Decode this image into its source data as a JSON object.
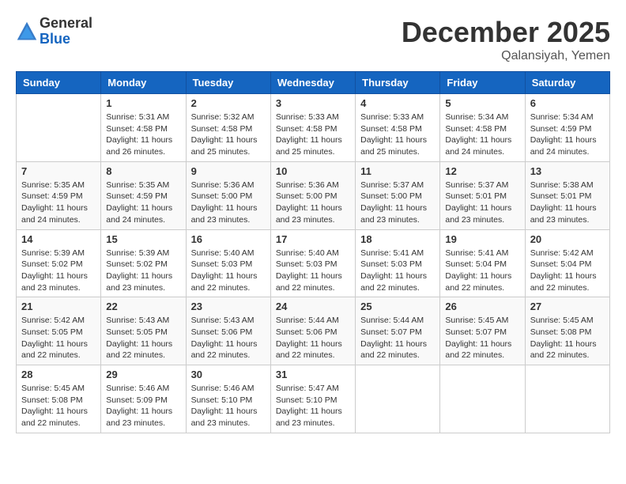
{
  "header": {
    "logo_general": "General",
    "logo_blue": "Blue",
    "month_title": "December 2025",
    "location": "Qalansiyah, Yemen"
  },
  "calendar": {
    "days_of_week": [
      "Sunday",
      "Monday",
      "Tuesday",
      "Wednesday",
      "Thursday",
      "Friday",
      "Saturday"
    ],
    "weeks": [
      [
        {
          "day": "",
          "info": ""
        },
        {
          "day": "1",
          "info": "Sunrise: 5:31 AM\nSunset: 4:58 PM\nDaylight: 11 hours\nand 26 minutes."
        },
        {
          "day": "2",
          "info": "Sunrise: 5:32 AM\nSunset: 4:58 PM\nDaylight: 11 hours\nand 25 minutes."
        },
        {
          "day": "3",
          "info": "Sunrise: 5:33 AM\nSunset: 4:58 PM\nDaylight: 11 hours\nand 25 minutes."
        },
        {
          "day": "4",
          "info": "Sunrise: 5:33 AM\nSunset: 4:58 PM\nDaylight: 11 hours\nand 25 minutes."
        },
        {
          "day": "5",
          "info": "Sunrise: 5:34 AM\nSunset: 4:58 PM\nDaylight: 11 hours\nand 24 minutes."
        },
        {
          "day": "6",
          "info": "Sunrise: 5:34 AM\nSunset: 4:59 PM\nDaylight: 11 hours\nand 24 minutes."
        }
      ],
      [
        {
          "day": "7",
          "info": "Sunrise: 5:35 AM\nSunset: 4:59 PM\nDaylight: 11 hours\nand 24 minutes."
        },
        {
          "day": "8",
          "info": "Sunrise: 5:35 AM\nSunset: 4:59 PM\nDaylight: 11 hours\nand 24 minutes."
        },
        {
          "day": "9",
          "info": "Sunrise: 5:36 AM\nSunset: 5:00 PM\nDaylight: 11 hours\nand 23 minutes."
        },
        {
          "day": "10",
          "info": "Sunrise: 5:36 AM\nSunset: 5:00 PM\nDaylight: 11 hours\nand 23 minutes."
        },
        {
          "day": "11",
          "info": "Sunrise: 5:37 AM\nSunset: 5:00 PM\nDaylight: 11 hours\nand 23 minutes."
        },
        {
          "day": "12",
          "info": "Sunrise: 5:37 AM\nSunset: 5:01 PM\nDaylight: 11 hours\nand 23 minutes."
        },
        {
          "day": "13",
          "info": "Sunrise: 5:38 AM\nSunset: 5:01 PM\nDaylight: 11 hours\nand 23 minutes."
        }
      ],
      [
        {
          "day": "14",
          "info": "Sunrise: 5:39 AM\nSunset: 5:02 PM\nDaylight: 11 hours\nand 23 minutes."
        },
        {
          "day": "15",
          "info": "Sunrise: 5:39 AM\nSunset: 5:02 PM\nDaylight: 11 hours\nand 23 minutes."
        },
        {
          "day": "16",
          "info": "Sunrise: 5:40 AM\nSunset: 5:03 PM\nDaylight: 11 hours\nand 22 minutes."
        },
        {
          "day": "17",
          "info": "Sunrise: 5:40 AM\nSunset: 5:03 PM\nDaylight: 11 hours\nand 22 minutes."
        },
        {
          "day": "18",
          "info": "Sunrise: 5:41 AM\nSunset: 5:03 PM\nDaylight: 11 hours\nand 22 minutes."
        },
        {
          "day": "19",
          "info": "Sunrise: 5:41 AM\nSunset: 5:04 PM\nDaylight: 11 hours\nand 22 minutes."
        },
        {
          "day": "20",
          "info": "Sunrise: 5:42 AM\nSunset: 5:04 PM\nDaylight: 11 hours\nand 22 minutes."
        }
      ],
      [
        {
          "day": "21",
          "info": "Sunrise: 5:42 AM\nSunset: 5:05 PM\nDaylight: 11 hours\nand 22 minutes."
        },
        {
          "day": "22",
          "info": "Sunrise: 5:43 AM\nSunset: 5:05 PM\nDaylight: 11 hours\nand 22 minutes."
        },
        {
          "day": "23",
          "info": "Sunrise: 5:43 AM\nSunset: 5:06 PM\nDaylight: 11 hours\nand 22 minutes."
        },
        {
          "day": "24",
          "info": "Sunrise: 5:44 AM\nSunset: 5:06 PM\nDaylight: 11 hours\nand 22 minutes."
        },
        {
          "day": "25",
          "info": "Sunrise: 5:44 AM\nSunset: 5:07 PM\nDaylight: 11 hours\nand 22 minutes."
        },
        {
          "day": "26",
          "info": "Sunrise: 5:45 AM\nSunset: 5:07 PM\nDaylight: 11 hours\nand 22 minutes."
        },
        {
          "day": "27",
          "info": "Sunrise: 5:45 AM\nSunset: 5:08 PM\nDaylight: 11 hours\nand 22 minutes."
        }
      ],
      [
        {
          "day": "28",
          "info": "Sunrise: 5:45 AM\nSunset: 5:08 PM\nDaylight: 11 hours\nand 22 minutes."
        },
        {
          "day": "29",
          "info": "Sunrise: 5:46 AM\nSunset: 5:09 PM\nDaylight: 11 hours\nand 23 minutes."
        },
        {
          "day": "30",
          "info": "Sunrise: 5:46 AM\nSunset: 5:10 PM\nDaylight: 11 hours\nand 23 minutes."
        },
        {
          "day": "31",
          "info": "Sunrise: 5:47 AM\nSunset: 5:10 PM\nDaylight: 11 hours\nand 23 minutes."
        },
        {
          "day": "",
          "info": ""
        },
        {
          "day": "",
          "info": ""
        },
        {
          "day": "",
          "info": ""
        }
      ]
    ]
  }
}
